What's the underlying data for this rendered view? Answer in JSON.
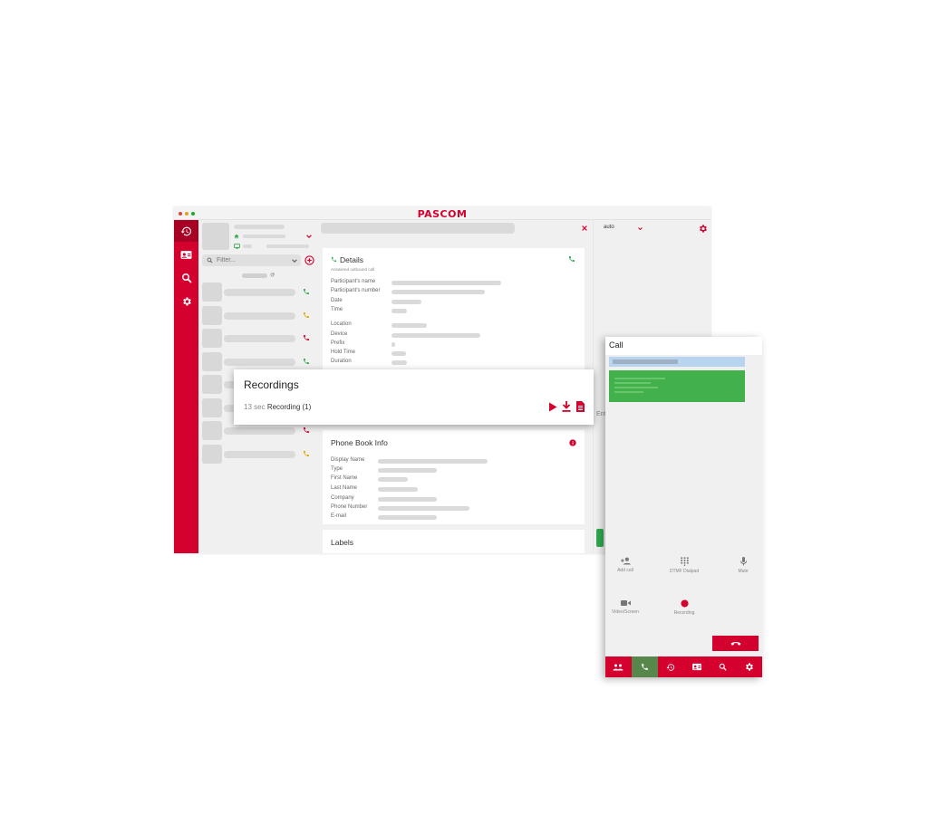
{
  "app": {
    "logo_text": "PASCOM"
  },
  "colors": {
    "brand": "#d4002e",
    "success": "#2fa84f",
    "warning": "#e8a200",
    "missed": "#d4002e",
    "active_tab": "#57874a"
  },
  "sidebar": {
    "items": [
      {
        "icon": "history-icon",
        "active": true
      },
      {
        "icon": "contacts-icon",
        "active": false
      },
      {
        "icon": "search-icon",
        "active": false
      },
      {
        "icon": "settings-icon",
        "active": false
      }
    ]
  },
  "filter": {
    "placeholder": "Filter..."
  },
  "call_list": {
    "rows": [
      {
        "status": "outgoing"
      },
      {
        "status": "incoming-yellow"
      },
      {
        "status": "missed"
      },
      {
        "status": "outgoing"
      },
      {
        "status": "outgoing"
      },
      {
        "status": "outgoing"
      },
      {
        "status": "missed"
      },
      {
        "status": "incoming-yellow"
      }
    ]
  },
  "details": {
    "title": "Details",
    "subtitle": "Answered outbound call",
    "fields": [
      "Participant's name",
      "Participant's number",
      "Date",
      "Time"
    ],
    "fields2": [
      "Location",
      "Device",
      "Prefix",
      "Hold Time",
      "Duration"
    ]
  },
  "recordings": {
    "title": "Recordings",
    "items": [
      {
        "duration": "13 sec",
        "name": "Recording (1)"
      }
    ]
  },
  "phonebook": {
    "title": "Phone Book Info",
    "fields": [
      "Display Name",
      "Type",
      "First Name",
      "Last Name",
      "Company",
      "Phone Number",
      "E-mail"
    ]
  },
  "labels": {
    "title": "Labels"
  },
  "right_panel": {
    "select_value": "auto",
    "input_partial": "Ent"
  },
  "mobile": {
    "title": "Call",
    "actions": [
      {
        "label": "Add call",
        "icon": "add-person-icon"
      },
      {
        "label": "DTMF Dialpad",
        "icon": "dialpad-icon"
      },
      {
        "label": "Mute",
        "icon": "microphone-icon"
      },
      {
        "label": "Video/Screen",
        "icon": "video-icon"
      },
      {
        "label": "Recording",
        "icon": "record-icon"
      }
    ],
    "tabs": [
      "team-icon",
      "phone-icon",
      "history-icon",
      "contacts-icon",
      "search-icon",
      "settings-icon"
    ],
    "active_tab": 1
  }
}
